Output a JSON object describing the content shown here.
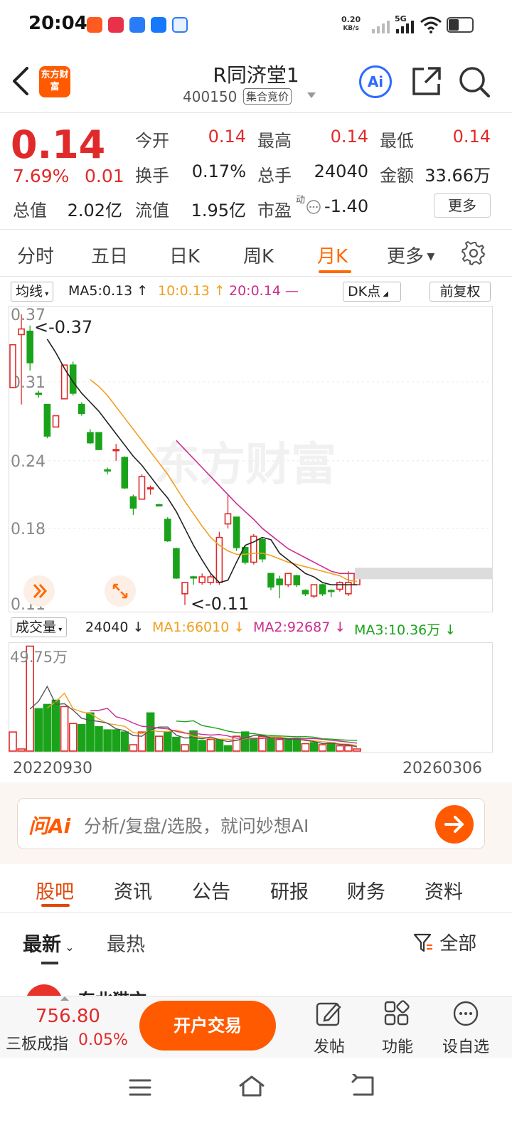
{
  "status_bar": {
    "time": "20:04",
    "net_speed_value": "0.20",
    "net_speed_unit": "KB/s",
    "network_type": "5G"
  },
  "header": {
    "logo_text": "东方财富",
    "title": "R同济堂1",
    "code": "400150",
    "tag": "集合竞价"
  },
  "quote": {
    "price": "0.14",
    "change_pct": "7.69%",
    "change_abs": "0.01",
    "open_label": "今开",
    "open": "0.14",
    "high_label": "最高",
    "high": "0.14",
    "low_label": "最低",
    "low": "0.14",
    "turnover_label": "换手",
    "turnover": "0.17%",
    "volume_label": "总手",
    "volume": "24040",
    "amount_label": "金额",
    "amount": "33.66万",
    "mcap_label": "总值",
    "mcap": "2.02亿",
    "float_label": "流值",
    "float": "1.95亿",
    "pe_label": "市盈",
    "pe_sup": "动",
    "pe": "-1.40",
    "more_label": "更多"
  },
  "period_tabs": [
    "分时",
    "五日",
    "日K",
    "周K",
    "月K",
    "更多"
  ],
  "active_period": "月K",
  "indicators": {
    "ma_selector": "均线",
    "ma5": "MA5:0.13 ↑",
    "ma10": "10:0.13 ↑",
    "ma20": "20:0.14 —",
    "dk_label": "DK点",
    "adjust_label": "前复权",
    "vol_selector": "成交量",
    "vol_value": "24040 ↓",
    "vma1": "MA1:66010 ↓",
    "vma2": "MA2:92687 ↓",
    "vma3": "MA3:10.36万 ↓"
  },
  "colors": {
    "up": "#e02a2a",
    "down": "#1aa31a",
    "ma5": "#222222",
    "ma10": "#f0a020",
    "ma20": "#cc2d8f",
    "brand": "#ff5a00"
  },
  "chart_data": {
    "type": "candlestick",
    "period": "monthly",
    "y_ticks": [
      "0.37",
      "0.31",
      "0.24",
      "0.18",
      "0.11"
    ],
    "annotation_high": "<-0.37",
    "annotation_low": "<-0.11",
    "watermark": "东方财富",
    "volume_max_label": "49.75万",
    "start_date": "20220930",
    "end_date": "20260306",
    "candles": [
      {
        "o": 0.305,
        "h": 0.305,
        "l": 0.305,
        "c": 0.343,
        "up": true
      },
      {
        "o": 0.357,
        "h": 0.37,
        "l": 0.29,
        "c": 0.352,
        "up": true
      },
      {
        "o": 0.355,
        "h": 0.36,
        "l": 0.32,
        "c": 0.327,
        "up": false
      },
      {
        "o": 0.3,
        "h": 0.302,
        "l": 0.296,
        "c": 0.3,
        "up": false
      },
      {
        "o": 0.29,
        "h": 0.29,
        "l": 0.26,
        "c": 0.262,
        "up": false
      },
      {
        "o": 0.27,
        "h": 0.28,
        "l": 0.27,
        "c": 0.28,
        "up": true
      },
      {
        "o": 0.295,
        "h": 0.325,
        "l": 0.295,
        "c": 0.325,
        "up": true
      },
      {
        "o": 0.325,
        "h": 0.328,
        "l": 0.298,
        "c": 0.3,
        "up": false
      },
      {
        "o": 0.29,
        "h": 0.292,
        "l": 0.28,
        "c": 0.282,
        "up": false
      },
      {
        "o": 0.265,
        "h": 0.268,
        "l": 0.255,
        "c": 0.256,
        "up": false
      },
      {
        "o": 0.265,
        "h": 0.265,
        "l": 0.25,
        "c": 0.25,
        "up": false
      },
      {
        "o": 0.232,
        "h": 0.234,
        "l": 0.228,
        "c": 0.232,
        "up": false
      },
      {
        "o": 0.25,
        "h": 0.255,
        "l": 0.24,
        "c": 0.25,
        "up": true
      },
      {
        "o": 0.243,
        "h": 0.244,
        "l": 0.215,
        "c": 0.216,
        "up": false
      },
      {
        "o": 0.208,
        "h": 0.21,
        "l": 0.192,
        "c": 0.198,
        "up": false
      },
      {
        "o": 0.206,
        "h": 0.228,
        "l": 0.206,
        "c": 0.226,
        "up": true
      },
      {
        "o": 0.215,
        "h": 0.218,
        "l": 0.21,
        "c": 0.216,
        "up": true
      },
      {
        "o": 0.201,
        "h": 0.202,
        "l": 0.2,
        "c": 0.201,
        "up": false
      },
      {
        "o": 0.188,
        "h": 0.19,
        "l": 0.168,
        "c": 0.169,
        "up": false
      },
      {
        "o": 0.162,
        "h": 0.163,
        "l": 0.135,
        "c": 0.136,
        "up": false
      },
      {
        "o": 0.122,
        "h": 0.132,
        "l": 0.112,
        "c": 0.132,
        "up": true
      },
      {
        "o": 0.137,
        "h": 0.138,
        "l": 0.13,
        "c": 0.137,
        "up": false
      },
      {
        "o": 0.132,
        "h": 0.14,
        "l": 0.13,
        "c": 0.137,
        "up": true
      },
      {
        "o": 0.132,
        "h": 0.14,
        "l": 0.13,
        "c": 0.137,
        "up": true
      },
      {
        "o": 0.132,
        "h": 0.177,
        "l": 0.13,
        "c": 0.172,
        "up": true
      },
      {
        "o": 0.184,
        "h": 0.21,
        "l": 0.18,
        "c": 0.193,
        "up": true
      },
      {
        "o": 0.19,
        "h": 0.19,
        "l": 0.16,
        "c": 0.163,
        "up": false
      },
      {
        "o": 0.163,
        "h": 0.165,
        "l": 0.148,
        "c": 0.15,
        "up": false
      },
      {
        "o": 0.15,
        "h": 0.175,
        "l": 0.148,
        "c": 0.173,
        "up": true
      },
      {
        "o": 0.17,
        "h": 0.172,
        "l": 0.15,
        "c": 0.153,
        "up": false
      },
      {
        "o": 0.14,
        "h": 0.14,
        "l": 0.125,
        "c": 0.128,
        "up": false
      },
      {
        "o": 0.135,
        "h": 0.138,
        "l": 0.118,
        "c": 0.13,
        "up": false
      },
      {
        "o": 0.13,
        "h": 0.14,
        "l": 0.128,
        "c": 0.14,
        "up": true
      },
      {
        "o": 0.138,
        "h": 0.139,
        "l": 0.128,
        "c": 0.13,
        "up": false
      },
      {
        "o": 0.125,
        "h": 0.126,
        "l": 0.12,
        "c": 0.122,
        "up": false
      },
      {
        "o": 0.12,
        "h": 0.13,
        "l": 0.118,
        "c": 0.13,
        "up": true
      },
      {
        "o": 0.13,
        "h": 0.131,
        "l": 0.12,
        "c": 0.122,
        "up": false
      },
      {
        "o": 0.125,
        "h": 0.126,
        "l": 0.119,
        "c": 0.125,
        "up": false
      },
      {
        "o": 0.126,
        "h": 0.133,
        "l": 0.124,
        "c": 0.132,
        "up": true
      },
      {
        "o": 0.122,
        "h": 0.142,
        "l": 0.12,
        "c": 0.132,
        "up": true
      },
      {
        "o": 0.13,
        "h": 0.142,
        "l": 0.13,
        "c": 0.14,
        "up": true
      }
    ],
    "ma5": [
      null,
      null,
      null,
      null,
      0.348,
      0.336,
      0.322,
      0.31,
      0.3,
      0.292,
      0.284,
      0.274,
      0.264,
      0.254,
      0.244,
      0.236,
      0.226,
      0.216,
      0.207,
      0.195,
      0.18,
      0.165,
      0.152,
      0.14,
      0.132,
      0.134,
      0.15,
      0.165,
      0.168,
      0.172,
      0.17,
      0.158,
      0.152,
      0.146,
      0.14,
      0.137,
      0.132,
      0.13,
      0.13,
      0.13,
      0.13
    ],
    "ma10": [
      null,
      null,
      null,
      null,
      null,
      null,
      null,
      null,
      null,
      0.312,
      0.306,
      0.298,
      0.288,
      0.278,
      0.268,
      0.258,
      0.248,
      0.238,
      0.228,
      0.216,
      0.204,
      0.193,
      0.182,
      0.172,
      0.165,
      0.16,
      0.157,
      0.157,
      0.158,
      0.158,
      0.156,
      0.153,
      0.15,
      0.148,
      0.146,
      0.144,
      0.142,
      0.14,
      0.138,
      0.134,
      0.133
    ],
    "ma20": [
      null,
      null,
      null,
      null,
      null,
      null,
      null,
      null,
      null,
      null,
      null,
      null,
      null,
      null,
      null,
      null,
      null,
      null,
      null,
      0.258,
      0.25,
      0.242,
      0.234,
      0.226,
      0.218,
      0.21,
      0.202,
      0.195,
      0.188,
      0.18,
      0.174,
      0.168,
      0.162,
      0.158,
      0.154,
      0.15,
      0.146,
      0.142,
      0.14,
      0.14,
      0.14
    ],
    "volume": [
      {
        "v": 0.18,
        "up": true
      },
      {
        "v": 0.02,
        "up": true
      },
      {
        "v": 0.99,
        "up": true
      },
      {
        "v": 0.4,
        "up": false
      },
      {
        "v": 0.44,
        "up": false
      },
      {
        "v": 0.48,
        "up": false
      },
      {
        "v": 0.42,
        "up": true
      },
      {
        "v": 0.26,
        "up": true
      },
      {
        "v": 0.25,
        "up": false
      },
      {
        "v": 0.36,
        "up": false
      },
      {
        "v": 0.23,
        "up": false
      },
      {
        "v": 0.2,
        "up": false
      },
      {
        "v": 0.2,
        "up": false
      },
      {
        "v": 0.18,
        "up": false
      },
      {
        "v": 0.06,
        "up": true
      },
      {
        "v": 0.18,
        "up": true
      },
      {
        "v": 0.36,
        "up": false
      },
      {
        "v": 0.14,
        "up": true
      },
      {
        "v": 0.18,
        "up": false
      },
      {
        "v": 0.13,
        "up": false
      },
      {
        "v": 0.06,
        "up": true
      },
      {
        "v": 0.19,
        "up": false
      },
      {
        "v": 0.1,
        "up": false
      },
      {
        "v": 0.11,
        "up": true
      },
      {
        "v": 0.11,
        "up": false
      },
      {
        "v": 0.05,
        "up": false
      },
      {
        "v": 0.14,
        "up": true
      },
      {
        "v": 0.18,
        "up": false
      },
      {
        "v": 0.12,
        "up": false
      },
      {
        "v": 0.14,
        "up": true
      },
      {
        "v": 0.12,
        "up": false
      },
      {
        "v": 0.11,
        "up": true
      },
      {
        "v": 0.11,
        "up": false
      },
      {
        "v": 0.12,
        "up": false
      },
      {
        "v": 0.07,
        "up": true
      },
      {
        "v": 0.08,
        "up": false
      },
      {
        "v": 0.06,
        "up": true
      },
      {
        "v": 0.08,
        "up": false
      },
      {
        "v": 0.05,
        "up": true
      },
      {
        "v": 0.05,
        "up": true
      },
      {
        "v": 0.02,
        "up": true
      }
    ]
  },
  "ai_bar": {
    "label": "问Ai",
    "placeholder": "分析/复盘/选股，就问妙想AI"
  },
  "content_tabs": [
    "股吧",
    "资讯",
    "公告",
    "研报",
    "财务",
    "资料"
  ],
  "sub_tabs": {
    "latest": "最新",
    "hot": "最热",
    "filter": "全部"
  },
  "partial_post": "东北猫文",
  "bottom_bar": {
    "index_value": "756.80",
    "index_name": "三板成指",
    "index_change": "0.05%",
    "trade_label": "开户交易",
    "post_label": "发帖",
    "function_label": "功能",
    "watch_label": "设自选"
  }
}
